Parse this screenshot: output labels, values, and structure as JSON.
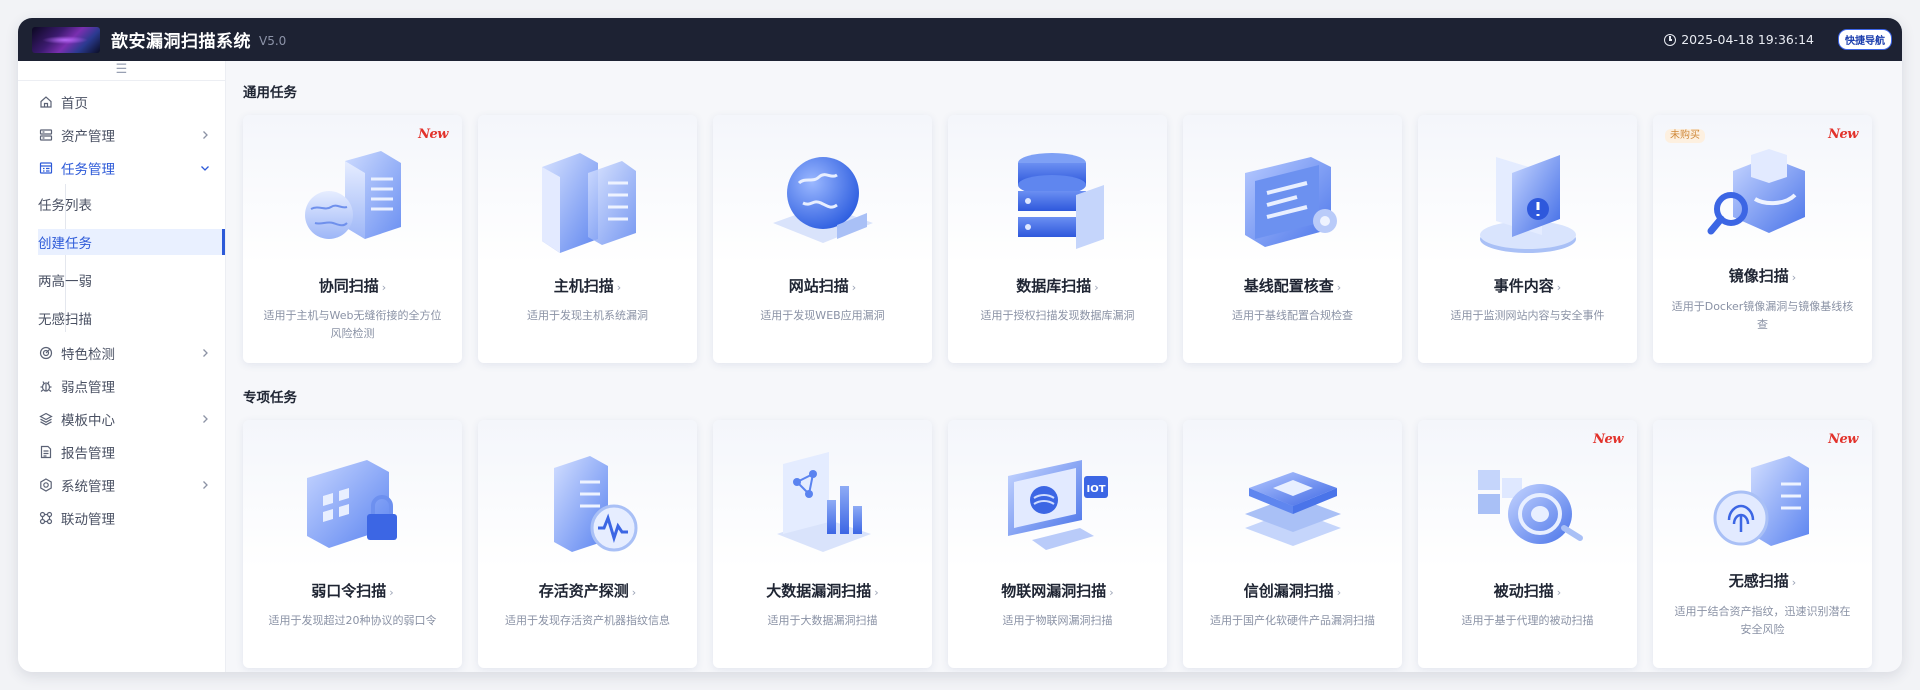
{
  "header": {
    "title": "歆安漏洞扫描系统",
    "version": "V5.0",
    "datetime": "2025-04-18 19:36:14",
    "quick_nav": "快捷导航"
  },
  "sidebar": {
    "toggle": "☰",
    "items": [
      {
        "label": "首页",
        "icon": "home-icon"
      },
      {
        "label": "资产管理",
        "icon": "server-icon"
      },
      {
        "label": "任务管理",
        "icon": "task-icon"
      },
      {
        "label": "特色检测",
        "icon": "scan-circle-icon"
      },
      {
        "label": "弱点管理",
        "icon": "bug-icon"
      },
      {
        "label": "模板中心",
        "icon": "layers-icon"
      },
      {
        "label": "报告管理",
        "icon": "report-icon"
      },
      {
        "label": "系统管理",
        "icon": "gear-icon"
      },
      {
        "label": "联动管理",
        "icon": "link-icon"
      }
    ],
    "task_sub": [
      "任务列表",
      "创建任务",
      "两高一弱",
      "无感扫描"
    ]
  },
  "sections": {
    "general": "通用任务",
    "special": "专项任务"
  },
  "badges": {
    "new": "New",
    "unpaid": "未购买"
  },
  "general_cards": [
    {
      "title": "协同扫描",
      "desc": "适用于主机与Web无缝衔接的全方位风险检测",
      "icon": "collab-scan-icon"
    },
    {
      "title": "主机扫描",
      "desc": "适用于发现主机系统漏洞",
      "icon": "host-scan-icon"
    },
    {
      "title": "网站扫描",
      "desc": "适用于发现WEB应用漏洞",
      "icon": "web-scan-icon"
    },
    {
      "title": "数据库扫描",
      "desc": "适用于授权扫描发现数据库漏洞",
      "icon": "database-scan-icon"
    },
    {
      "title": "基线配置核查",
      "desc": "适用于基线配置合规检查",
      "icon": "baseline-icon"
    },
    {
      "title": "事件内容",
      "desc": "适用于监测网站内容与安全事件",
      "icon": "event-icon"
    },
    {
      "title": "镜像扫描",
      "desc": "适用于Docker镜像漏洞与镜像基线核查",
      "icon": "image-scan-icon"
    }
  ],
  "special_cards": [
    {
      "title": "弱口令扫描",
      "desc": "适用于发现超过20种协议的弱口令",
      "icon": "weak-password-icon"
    },
    {
      "title": "存活资产探测",
      "desc": "适用于发现存活资产机器指纹信息",
      "icon": "live-asset-icon"
    },
    {
      "title": "大数据漏洞扫描",
      "desc": "适用于大数据漏洞扫描",
      "icon": "bigdata-icon"
    },
    {
      "title": "物联网漏洞扫描",
      "desc": "适用于物联网漏洞扫描",
      "icon": "iot-icon"
    },
    {
      "title": "信创漏洞扫描",
      "desc": "适用于国产化软硬件产品漏洞扫描",
      "icon": "xinchuang-icon"
    },
    {
      "title": "被动扫描",
      "desc": "适用于基于代理的被动扫描",
      "icon": "passive-scan-icon"
    },
    {
      "title": "无感扫描",
      "desc": "适用于结合资产指纹，迅速识别潜在安全风险",
      "icon": "fingerprint-scan-icon"
    }
  ],
  "colors": {
    "accent": "#2d5ad8",
    "header_bg": "#1d2233",
    "new_badge": "#e2322b"
  }
}
